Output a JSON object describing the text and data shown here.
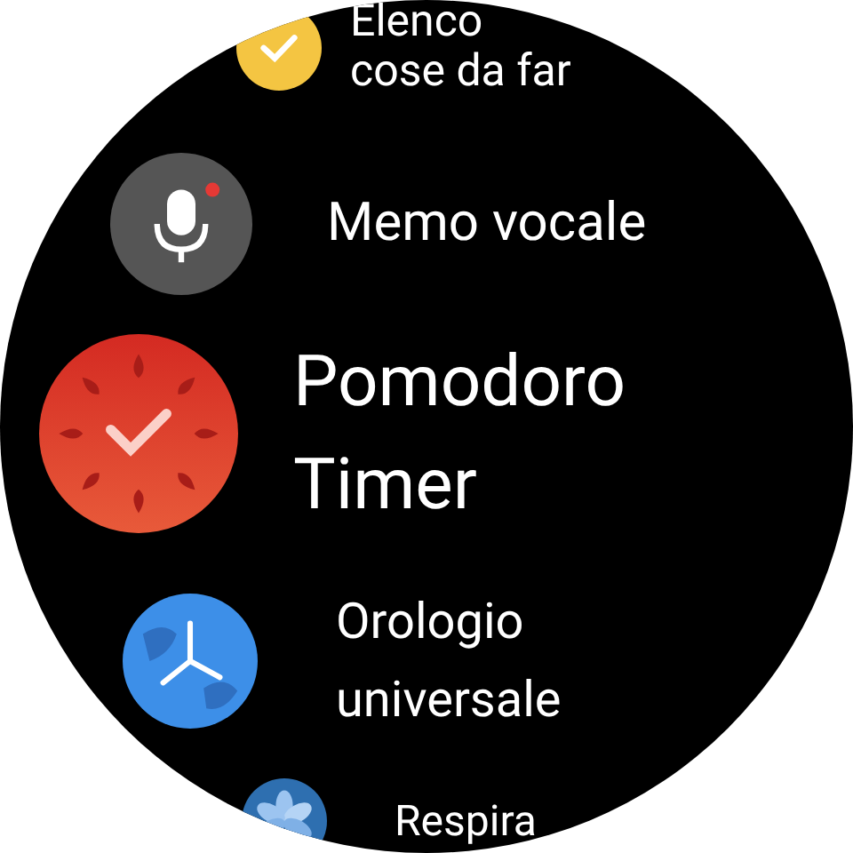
{
  "apps": [
    {
      "kind": "todo",
      "lines": [
        "Elenco",
        "cose da far"
      ]
    },
    {
      "kind": "voice",
      "lines": [
        "Memo vocale"
      ]
    },
    {
      "kind": "pomodoro",
      "lines": [
        "Pomodoro",
        "Timer"
      ]
    },
    {
      "kind": "worldclock",
      "lines": [
        "Orologio",
        "universale"
      ]
    },
    {
      "kind": "breathe",
      "lines": [
        "Respira"
      ]
    }
  ]
}
